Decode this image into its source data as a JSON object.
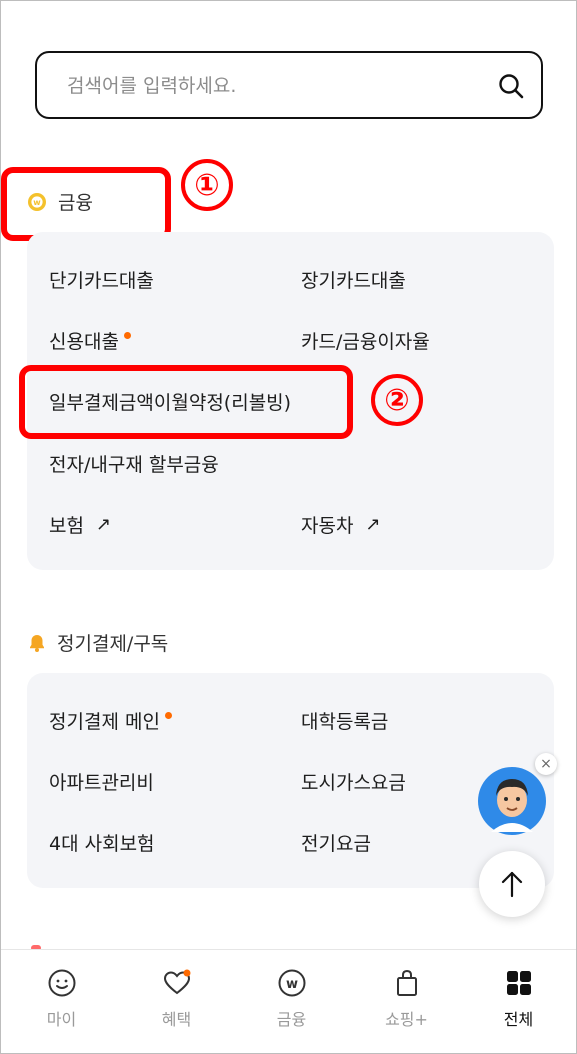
{
  "search": {
    "placeholder": "검색어를 입력하세요."
  },
  "finance": {
    "title": "금융",
    "items": [
      {
        "label": "단기카드대출"
      },
      {
        "label": "장기카드대출"
      },
      {
        "label": "신용대출"
      },
      {
        "label": "카드/금융이자율"
      },
      {
        "label": "일부결제금액이월약정(리볼빙)"
      },
      {
        "label": "전자/내구재 할부금융"
      },
      {
        "label": "보험",
        "arrow": "↗"
      },
      {
        "label": "자동차",
        "arrow": "↗"
      }
    ]
  },
  "subscription": {
    "title": "정기결제/구독",
    "items": [
      {
        "label": "정기결제 메인"
      },
      {
        "label": "대학등록금"
      },
      {
        "label": "아파트관리비"
      },
      {
        "label": "도시가스요금"
      },
      {
        "label": "4대 사회보험"
      },
      {
        "label": "전기요금"
      }
    ]
  },
  "annotations": {
    "one": "①",
    "two": "②"
  },
  "floating": {
    "close": "×"
  },
  "bottom_nav": [
    {
      "label": "마이",
      "icon": "smile-icon"
    },
    {
      "label": "혜택",
      "icon": "heart-icon"
    },
    {
      "label": "금융",
      "icon": "won-coin-icon"
    },
    {
      "label": "쇼핑+",
      "icon": "shopping-bag-icon"
    },
    {
      "label": "전체",
      "icon": "grid-icon",
      "active": true
    }
  ],
  "colors": {
    "accent_dot": "#ff6a00",
    "annotation": "#ff0000",
    "card_bg": "#f4f5f8",
    "coin": "#f4c12c",
    "bell": "#f5a623"
  }
}
